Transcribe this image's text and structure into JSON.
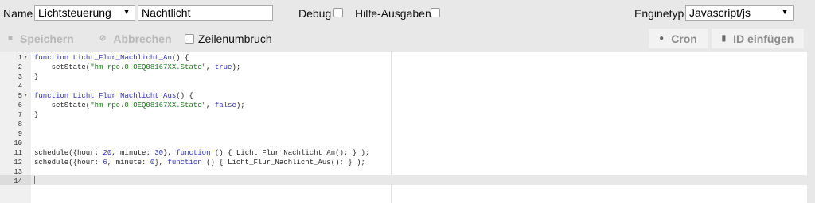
{
  "toolbar": {
    "name_label": "Name",
    "group_select": "Lichtsteuerung",
    "name_value": "Nachtlicht",
    "debug_label": "Debug",
    "hilfe_label": "Hilfe-Ausgaben",
    "enginetyp_label": "Enginetyp",
    "enginetyp_value": "Javascript/js"
  },
  "actions": {
    "save_label": "Speichern",
    "cancel_label": "Abbrechen",
    "wrap_label": "Zeilenumbruch",
    "cron_label": "Cron",
    "insert_id_label": "ID einfügen"
  },
  "editor": {
    "active_line": 14,
    "lines": [
      {
        "n": "1",
        "fold": true,
        "tokens": [
          {
            "t": "kw",
            "v": "function"
          },
          {
            "t": "plain",
            "v": " "
          },
          {
            "t": "fn",
            "v": "Licht_Flur_Nachlicht_An"
          },
          {
            "t": "plain",
            "v": "() {"
          }
        ]
      },
      {
        "n": "2",
        "fold": false,
        "tokens": [
          {
            "t": "plain",
            "v": "    setState("
          },
          {
            "t": "str",
            "v": "\"hm-rpc.0.OEQ08167XX.State\""
          },
          {
            "t": "plain",
            "v": ", "
          },
          {
            "t": "bool",
            "v": "true"
          },
          {
            "t": "plain",
            "v": ");"
          }
        ]
      },
      {
        "n": "3",
        "fold": false,
        "tokens": [
          {
            "t": "plain",
            "v": "}"
          }
        ]
      },
      {
        "n": "4",
        "fold": false,
        "tokens": []
      },
      {
        "n": "5",
        "fold": true,
        "tokens": [
          {
            "t": "kw",
            "v": "function"
          },
          {
            "t": "plain",
            "v": " "
          },
          {
            "t": "fn",
            "v": "Licht_Flur_Nachlicht_Aus"
          },
          {
            "t": "plain",
            "v": "() {"
          }
        ]
      },
      {
        "n": "6",
        "fold": false,
        "tokens": [
          {
            "t": "plain",
            "v": "    setState("
          },
          {
            "t": "str",
            "v": "\"hm-rpc.0.OEQ08167XX.State\""
          },
          {
            "t": "plain",
            "v": ", "
          },
          {
            "t": "bool",
            "v": "false"
          },
          {
            "t": "plain",
            "v": ");"
          }
        ]
      },
      {
        "n": "7",
        "fold": false,
        "tokens": [
          {
            "t": "plain",
            "v": "}"
          }
        ]
      },
      {
        "n": "8",
        "fold": false,
        "tokens": []
      },
      {
        "n": "9",
        "fold": false,
        "tokens": []
      },
      {
        "n": "10",
        "fold": false,
        "tokens": []
      },
      {
        "n": "11",
        "fold": false,
        "tokens": [
          {
            "t": "plain",
            "v": "schedule({hour: "
          },
          {
            "t": "num",
            "v": "20"
          },
          {
            "t": "plain",
            "v": ", minute: "
          },
          {
            "t": "num",
            "v": "30"
          },
          {
            "t": "plain",
            "v": "}, "
          },
          {
            "t": "kw",
            "v": "function"
          },
          {
            "t": "plain",
            "v": " () { Licht_Flur_Nachlicht_An(); } );"
          }
        ]
      },
      {
        "n": "12",
        "fold": false,
        "tokens": [
          {
            "t": "plain",
            "v": "schedule({hour: "
          },
          {
            "t": "num",
            "v": "6"
          },
          {
            "t": "plain",
            "v": ", minute: "
          },
          {
            "t": "num",
            "v": "0"
          },
          {
            "t": "plain",
            "v": "}, "
          },
          {
            "t": "kw",
            "v": "function"
          },
          {
            "t": "plain",
            "v": " () { Licht_Flur_Nachlicht_Aus(); } );"
          }
        ]
      },
      {
        "n": "13",
        "fold": false,
        "tokens": []
      },
      {
        "n": "14",
        "fold": false,
        "tokens": []
      }
    ]
  },
  "icons": {
    "save": "floppy-icon",
    "cancel": "cancel-icon",
    "cron": "clock-icon",
    "insert_id": "list-icon"
  }
}
